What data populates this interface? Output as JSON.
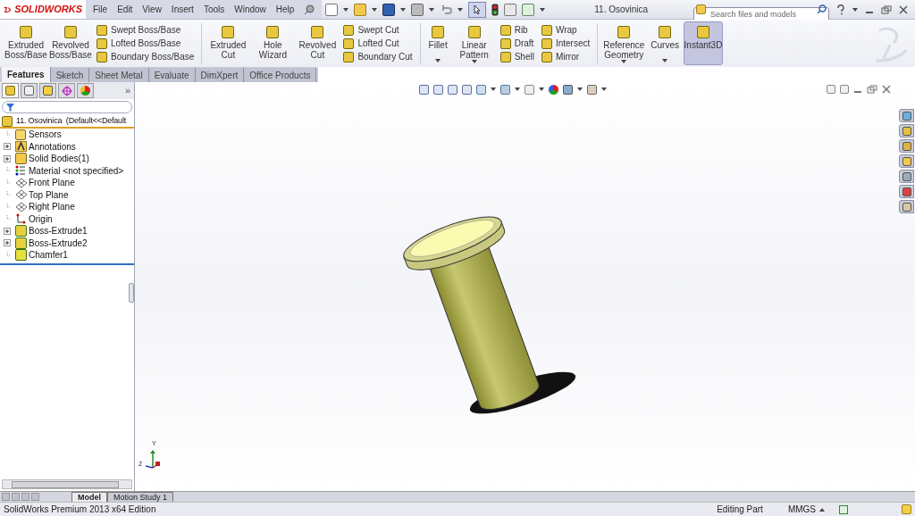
{
  "title_bar": {
    "logo": "SOLIDWORKS",
    "menu": [
      "File",
      "Edit",
      "View",
      "Insert",
      "Tools",
      "Window",
      "Help"
    ],
    "document_title": "11. Osovinica",
    "search": {
      "placeholder": "Search files and models"
    }
  },
  "ribbon": [
    {
      "kind": "large",
      "label": "Extruded Boss/Base",
      "dropdown": false,
      "selected": false
    },
    {
      "kind": "large",
      "label": "Revolved Boss/Base",
      "dropdown": false,
      "selected": false
    },
    {
      "kind": "stack",
      "items": [
        "Swept Boss/Base",
        "Lofted Boss/Base",
        "Boundary Boss/Base"
      ]
    },
    {
      "kind": "divider"
    },
    {
      "kind": "large",
      "label": "Extruded Cut",
      "dropdown": false,
      "selected": false
    },
    {
      "kind": "large",
      "label": "Hole Wizard",
      "dropdown": false,
      "selected": false
    },
    {
      "kind": "large",
      "label": "Revolved Cut",
      "dropdown": false,
      "selected": false
    },
    {
      "kind": "stack",
      "items": [
        "Swept Cut",
        "Lofted Cut",
        "Boundary Cut"
      ]
    },
    {
      "kind": "divider"
    },
    {
      "kind": "large",
      "label": "Fillet",
      "dropdown": true,
      "selected": false
    },
    {
      "kind": "large",
      "label": "Linear Pattern",
      "dropdown": true,
      "selected": false
    },
    {
      "kind": "stack",
      "items": [
        "Rib",
        "Draft",
        "Shell"
      ]
    },
    {
      "kind": "stack",
      "items": [
        "Wrap",
        "Intersect",
        "Mirror"
      ]
    },
    {
      "kind": "divider"
    },
    {
      "kind": "large",
      "label": "Reference Geometry",
      "dropdown": true,
      "selected": false
    },
    {
      "kind": "large",
      "label": "Curves",
      "dropdown": true,
      "selected": false
    },
    {
      "kind": "large",
      "label": "Instant3D",
      "dropdown": false,
      "selected": true
    }
  ],
  "command_tabs": [
    {
      "label": "Features",
      "selected": true
    },
    {
      "label": "Sketch",
      "selected": false
    },
    {
      "label": "Sheet Metal",
      "selected": false
    },
    {
      "label": "Evaluate",
      "selected": false
    },
    {
      "label": "DimXpert",
      "selected": false
    },
    {
      "label": "Office Products",
      "selected": false
    }
  ],
  "feature_tree": {
    "more": "»",
    "root": "11. Osovinica  (Default<<Default",
    "items": [
      {
        "label": "Sensors",
        "kind": "leaf"
      },
      {
        "label": "Annotations",
        "kind": "collapsed"
      },
      {
        "label": "Solid Bodies(1)",
        "kind": "collapsed"
      },
      {
        "label": "Material <not specified>",
        "kind": "leaf"
      },
      {
        "label": "Front Plane",
        "kind": "leaf"
      },
      {
        "label": "Top Plane",
        "kind": "leaf"
      },
      {
        "label": "Right Plane",
        "kind": "leaf"
      },
      {
        "label": "Origin",
        "kind": "leaf"
      },
      {
        "label": "Boss-Extrude1",
        "kind": "collapsed"
      },
      {
        "label": "Boss-Extrude2",
        "kind": "collapsed"
      },
      {
        "label": "Chamfer1",
        "kind": "leaf"
      }
    ]
  },
  "triad": {
    "y": "Y",
    "z": "Z"
  },
  "bottom_tabs": [
    {
      "label": "Model",
      "selected": true
    },
    {
      "label": "Motion Study 1",
      "selected": false
    }
  ],
  "status_bar": {
    "product": "SolidWorks Premium 2013 x64 Edition",
    "mode": "Editing Part",
    "units": "MMGS"
  }
}
